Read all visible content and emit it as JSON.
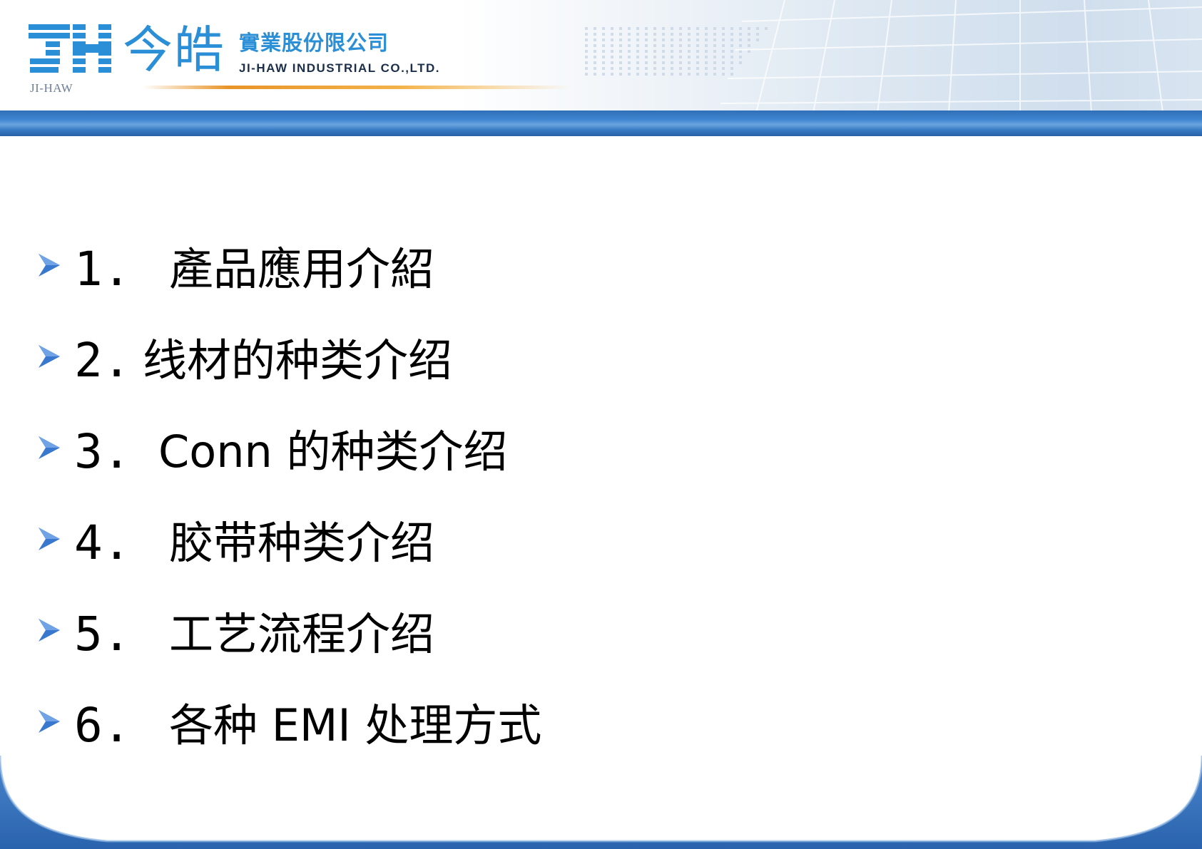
{
  "header": {
    "logo_sub": "JI-HAW",
    "brand_cn": "今皓",
    "company_cn": "實業股份限公司",
    "company_en": "JI-HAW INDUSTRIAL CO.,LTD."
  },
  "agenda": {
    "items": [
      {
        "num": "1.",
        "text": "產品應用介紹"
      },
      {
        "num": "2.",
        "text": "线材的种类介绍"
      },
      {
        "num": "3.",
        "text": "Conn 的种类介绍"
      },
      {
        "num": "4.",
        "text": "胶带种类介绍"
      },
      {
        "num": "5.",
        "text": "工艺流程介绍"
      },
      {
        "num": "6.",
        "text": "各种 EMI 处理方式"
      }
    ]
  },
  "colors": {
    "brand_blue": "#2a8fd6",
    "bar_blue": "#3f85cf",
    "accent_orange": "#e89428",
    "bullet_blue": "#3a78d0"
  }
}
